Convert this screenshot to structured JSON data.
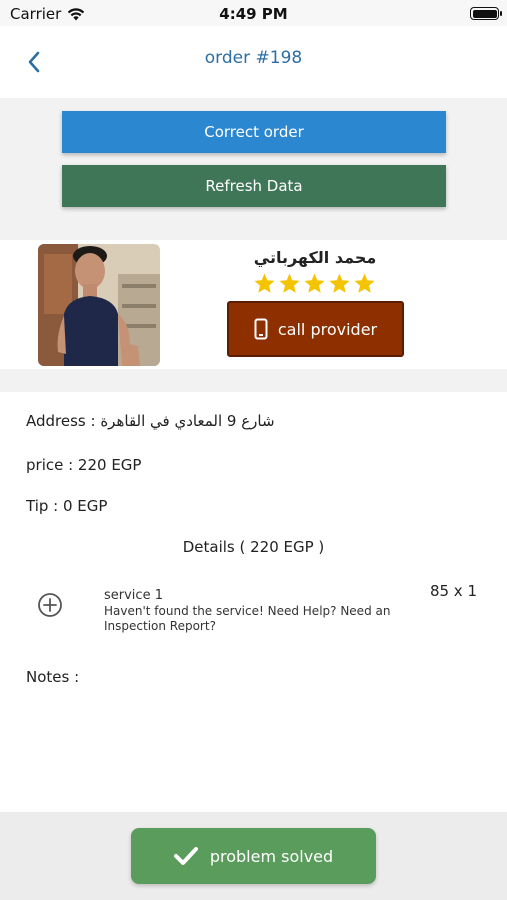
{
  "status_bar": {
    "carrier": "Carrier",
    "time": "4:49 PM"
  },
  "nav": {
    "title": "order #198"
  },
  "actions": {
    "correct_label": "Correct order",
    "refresh_label": "Refresh Data"
  },
  "provider": {
    "name": "محمد الكهرباتي",
    "rating": 5,
    "call_label": "call provider"
  },
  "order": {
    "address_line": "Address : شارع 9 المعادي في القاهرة",
    "price_line": "price : 220 EGP",
    "tip_line": "Tip : 0 EGP",
    "details_heading": "Details ( 220 EGP )",
    "services": [
      {
        "name": "service 1",
        "help": "Haven't found the service! Need Help? Need an Inspection Report?",
        "quantity": "85 x 1"
      }
    ],
    "notes_label": "Notes :"
  },
  "footer": {
    "solved_label": "problem solved"
  },
  "colors": {
    "accent_blue": "#2b87d0",
    "refresh_green": "#3f7658",
    "call_brown": "#8e2f00",
    "star_yellow": "#f5c400",
    "solved_green": "#5a9c5c"
  }
}
